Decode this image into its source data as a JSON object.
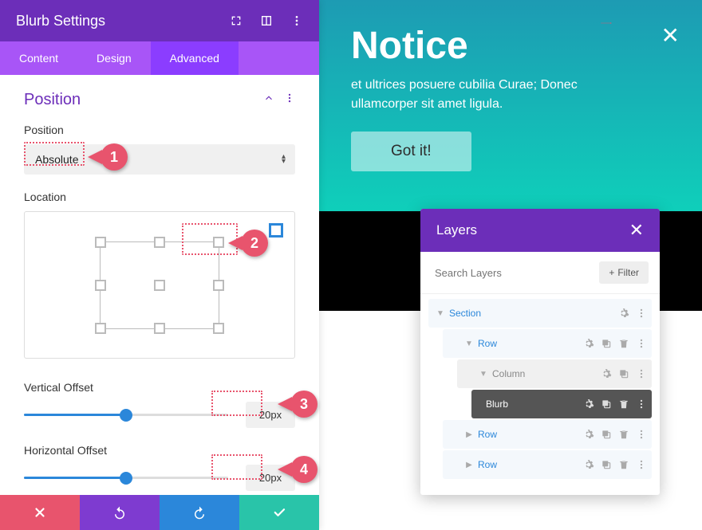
{
  "settings": {
    "title": "Blurb Settings",
    "tabs": {
      "content": "Content",
      "design": "Design",
      "advanced": "Advanced"
    },
    "section": {
      "title": "Position"
    },
    "fields": {
      "position_label": "Position",
      "position_value": "Absolute",
      "location_label": "Location",
      "vertical_offset_label": "Vertical Offset",
      "vertical_offset_value": "20px",
      "horizontal_offset_label": "Horizontal Offset",
      "horizontal_offset_value": "20px"
    }
  },
  "preview": {
    "title": "Notice",
    "body_line1": "et ultrices posuere cubilia Curae; Donec",
    "body_line2": "ullamcorper sit amet ligula.",
    "button": "Got it!"
  },
  "layers": {
    "title": "Layers",
    "search_placeholder": "Search Layers",
    "filter_label": "Filter",
    "items": {
      "section": "Section",
      "row1": "Row",
      "column": "Column",
      "blurb": "Blurb",
      "row2": "Row",
      "row3": "Row"
    }
  },
  "callouts": {
    "c1": "1",
    "c2": "2",
    "c3": "3",
    "c4": "4"
  },
  "colors": {
    "purple": "#6c2eb9",
    "accent_purple": "#8b3dff",
    "blue": "#2b87da",
    "green": "#29c4a9",
    "red": "#e8546d"
  }
}
